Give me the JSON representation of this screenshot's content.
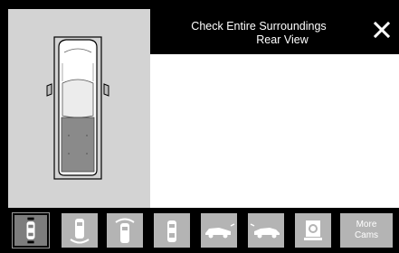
{
  "header": {
    "title_line1": "Check Entire Surroundings",
    "title_line2": "Rear View"
  },
  "icons": {
    "close": "close-icon",
    "vehicle": "vehicle-top-down-icon"
  },
  "toolbar": {
    "buttons": [
      {
        "name": "front-rear-view-button",
        "icon": "car-front-rear-cam-icon",
        "selected": true
      },
      {
        "name": "rear-view-button",
        "icon": "car-rear-cam-icon",
        "selected": false
      },
      {
        "name": "front-view-button",
        "icon": "car-front-cam-icon",
        "selected": false
      },
      {
        "name": "side-view-button",
        "icon": "car-side-cam-icon",
        "selected": false
      },
      {
        "name": "front-cross-view-button",
        "icon": "car-front-cross-icon",
        "selected": false
      },
      {
        "name": "rear-cross-view-button",
        "icon": "car-rear-cross-icon",
        "selected": false
      },
      {
        "name": "trailer-cam-button",
        "icon": "camera-icon",
        "selected": false
      }
    ],
    "more_line1": "More",
    "more_line2": "Cams"
  },
  "colors": {
    "panel": "#d3d3d3",
    "button": "#b4b4b4",
    "button_selected": "#7d7d7d",
    "background": "#000000",
    "camera_view": "#ffffff"
  }
}
